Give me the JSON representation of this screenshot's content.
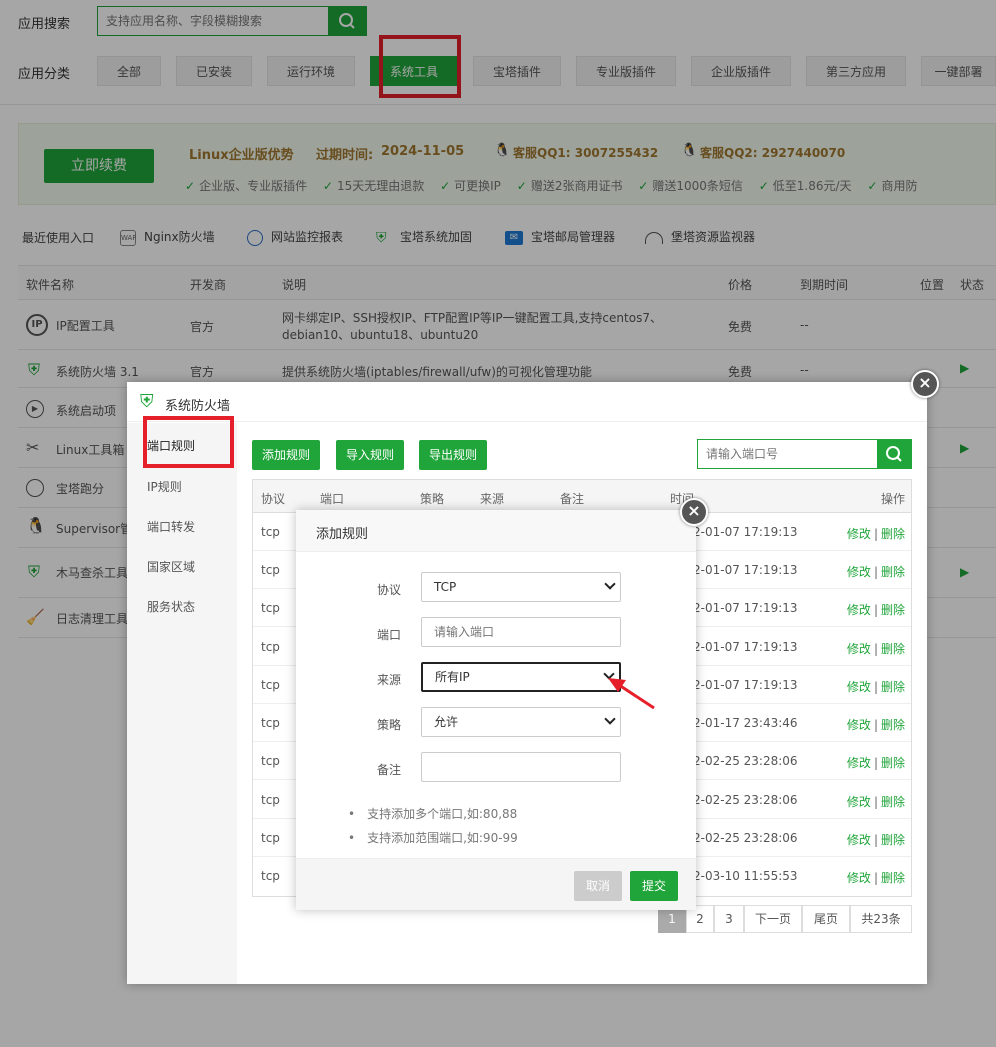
{
  "search": {
    "label": "应用搜索",
    "placeholder": "支持应用名称、字段模糊搜索"
  },
  "category": {
    "label": "应用分类",
    "tabs": [
      "全部",
      "已安装",
      "运行环境",
      "系统工具",
      "宝塔插件",
      "专业版插件",
      "企业版插件",
      "第三方应用",
      "一键部署"
    ]
  },
  "promo": {
    "renew_button": "立即续费",
    "title": "Linux企业版优势",
    "expire_label": "过期时间:",
    "expire_date": "2024-11-05",
    "qq1": "客服QQ1: 3007255432",
    "qq2": "客服QQ2: 2927440070",
    "perks": [
      "企业版、专业版插件",
      "15天无理由退款",
      "可更换IP",
      "赠送2张商用证书",
      "赠送1000条短信",
      "低至1.86元/天",
      "商用防"
    ]
  },
  "recent": {
    "label": "最近使用入口",
    "items": [
      "Nginx防火墙",
      "网站监控报表",
      "宝塔系统加固",
      "宝塔邮局管理器",
      "堡塔资源监视器"
    ]
  },
  "table": {
    "headers": [
      "软件名称",
      "开发商",
      "说明",
      "价格",
      "到期时间",
      "位置",
      "状态"
    ],
    "rows": [
      {
        "name": "IP配置工具",
        "dev": "官方",
        "desc1": "网卡绑定IP、SSH授权IP、FTP配置IP等IP一键配置工具,支持centos7、",
        "desc2": "debian10、ubuntu18、ubuntu20",
        "price": "免费",
        "expire": "--"
      },
      {
        "name": "系统防火墙 3.1",
        "dev": "官方",
        "desc1": "提供系统防火墙(iptables/firewall/ufw)的可视化管理功能",
        "price": "免费",
        "expire": "--"
      },
      {
        "name": "系统启动项"
      },
      {
        "name": "Linux工具箱"
      },
      {
        "name": "宝塔跑分"
      },
      {
        "name": "Supervisor管"
      },
      {
        "name": "木马查杀工具"
      },
      {
        "name": "日志清理工具"
      }
    ]
  },
  "firewall": {
    "title": "系统防火墙",
    "nav": [
      "端口规则",
      "IP规则",
      "端口转发",
      "国家区域",
      "服务状态"
    ],
    "buttons": {
      "add": "添加规则",
      "import": "导入规则",
      "export": "导出规则"
    },
    "search_placeholder": "请输入端口号",
    "headers": [
      "协议",
      "端口",
      "策略",
      "来源",
      "备注",
      "时间",
      "操作"
    ],
    "rows": [
      {
        "proto": "tcp",
        "time": "2-01-07 17:19:13"
      },
      {
        "proto": "tcp",
        "time": "2-01-07 17:19:13"
      },
      {
        "proto": "tcp",
        "time": "2-01-07 17:19:13"
      },
      {
        "proto": "tcp",
        "time": "2-01-07 17:19:13"
      },
      {
        "proto": "tcp",
        "time": "2-01-07 17:19:13"
      },
      {
        "proto": "tcp",
        "time": "2-01-17 23:43:46"
      },
      {
        "proto": "tcp",
        "time": "2-02-25 23:28:06"
      },
      {
        "proto": "tcp",
        "time": "2-02-25 23:28:06"
      },
      {
        "proto": "tcp",
        "time": "2-02-25 23:28:06"
      },
      {
        "proto": "tcp",
        "time": "2-03-10 11:55:53"
      }
    ],
    "op_edit": "修改",
    "op_sep": "|",
    "op_delete": "删除",
    "pager": [
      "1",
      "2",
      "3",
      "下一页",
      "尾页",
      "共23条"
    ]
  },
  "modal": {
    "title": "添加规则",
    "protocol_label": "协议",
    "protocol_value": "TCP",
    "port_label": "端口",
    "port_placeholder": "请输入端口",
    "source_label": "来源",
    "source_value": "所有IP",
    "strategy_label": "策略",
    "strategy_value": "允许",
    "remark_label": "备注",
    "tips": [
      "支持添加多个端口,如:80,88",
      "支持添加范围端口,如:90-99"
    ],
    "cancel": "取消",
    "submit": "提交"
  },
  "colors": {
    "accent": "#20a53a",
    "highlight": "#e5202a"
  }
}
